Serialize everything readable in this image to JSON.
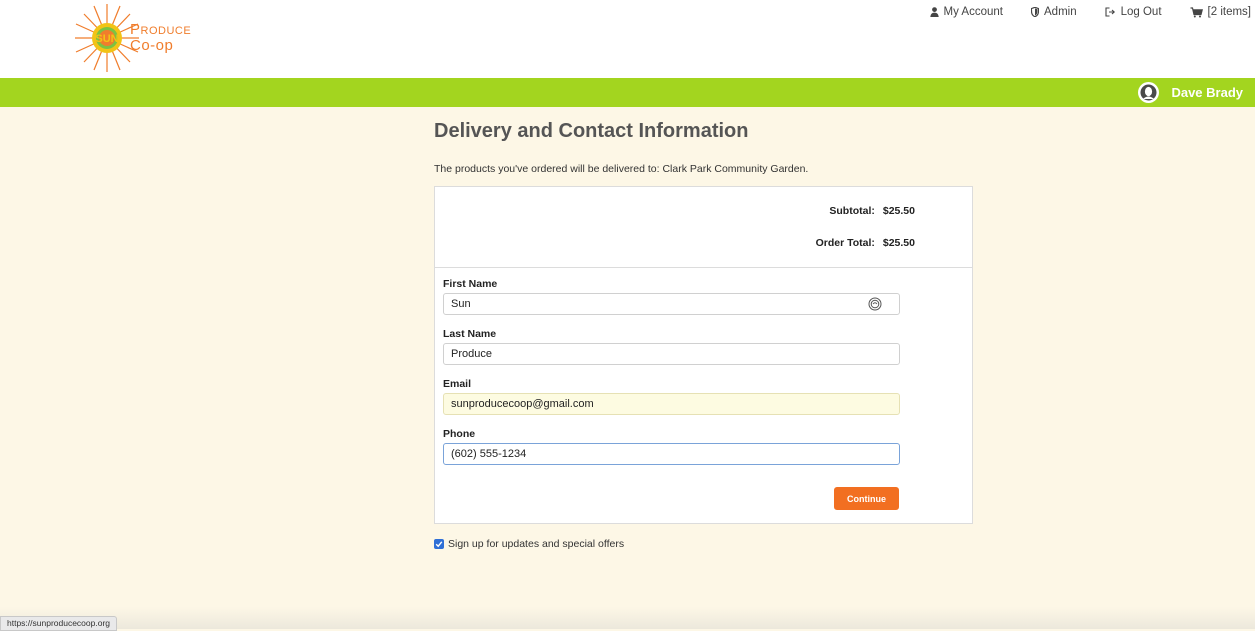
{
  "brand": {
    "line1": "Produce",
    "line2": "Co-op",
    "badge": "SUN",
    "colors": {
      "orange": "#f07d2c",
      "yellow": "#f2c316",
      "green": "#a3d51f"
    }
  },
  "nav": {
    "my_account": "My Account",
    "admin": "Admin",
    "logout": "Log Out",
    "cart": "[2 items]"
  },
  "user": {
    "name": "Dave Brady"
  },
  "page": {
    "title": "Delivery and Contact Information",
    "delivery_text": "The products you've ordered will be delivered to: Clark Park Community Garden."
  },
  "totals": {
    "subtotal_label": "Subtotal:",
    "subtotal_value": "$25.50",
    "order_total_label": "Order Total:",
    "order_total_value": "$25.50"
  },
  "form": {
    "first_name_label": "First Name",
    "first_name_value": "Sun",
    "last_name_label": "Last Name",
    "last_name_value": "Produce",
    "email_label": "Email",
    "email_value": "sunproducecoop@gmail.com",
    "phone_label": "Phone",
    "phone_value": "(602) 555-1234",
    "continue_label": "Continue"
  },
  "signup": {
    "label": "Sign up for updates and special offers",
    "checked": true
  },
  "status_bar": {
    "url": "https://sunproducecoop.org"
  }
}
